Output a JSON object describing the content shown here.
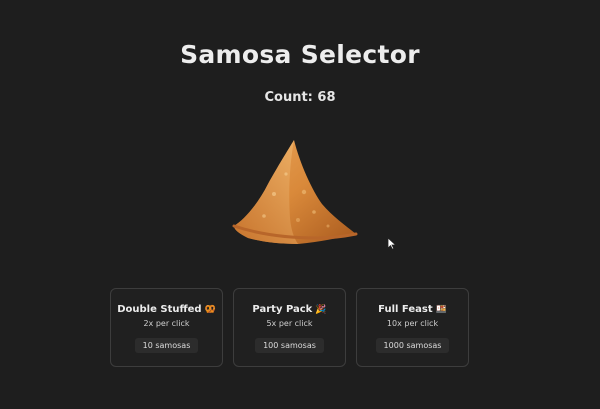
{
  "header": {
    "title": "Samosa Selector",
    "count_label": "Count: 68"
  },
  "samosa": {
    "icon": "samosa-icon"
  },
  "upgrades": [
    {
      "name": "Double Stuffed",
      "emoji": "🥨",
      "rate": "2x per click",
      "cost": "10 samosas"
    },
    {
      "name": "Party Pack",
      "emoji": "🎉",
      "rate": "5x per click",
      "cost": "100 samosas"
    },
    {
      "name": "Full Feast",
      "emoji": "🍱",
      "rate": "10x per click",
      "cost": "1000 samosas"
    }
  ],
  "colors": {
    "background": "#1e1e1e",
    "card_border": "#3d3d3d",
    "samosa_crust": "#d9893a"
  }
}
